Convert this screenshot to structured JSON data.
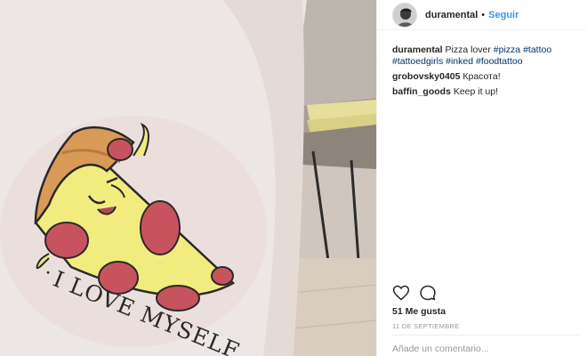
{
  "post": {
    "username": "duramental",
    "separator": "•",
    "follow_label": "Seguir",
    "tattoo_text": "I LOVE MYSELF"
  },
  "caption": {
    "username": "duramental",
    "text": " Pizza lover ",
    "tags": [
      "#pizza",
      "#tattoo",
      "#tattoedgirls",
      "#inked",
      "#foodtattoo"
    ]
  },
  "comments": [
    {
      "username": "grobovsky0405",
      "text": " Красота!"
    },
    {
      "username": "baffin_goods",
      "text": " Keep it up!"
    }
  ],
  "actions": {
    "like_icon": "heart-icon",
    "comment_icon": "comment-icon"
  },
  "likes_label": "51 Me gusta",
  "date_label": "11 DE SEPTIEMBRE",
  "add_comment_placeholder": "Añade un comentario...",
  "colors": {
    "link": "#3897f0",
    "hashtag": "#003569",
    "meta": "#999999",
    "text": "#262626"
  }
}
